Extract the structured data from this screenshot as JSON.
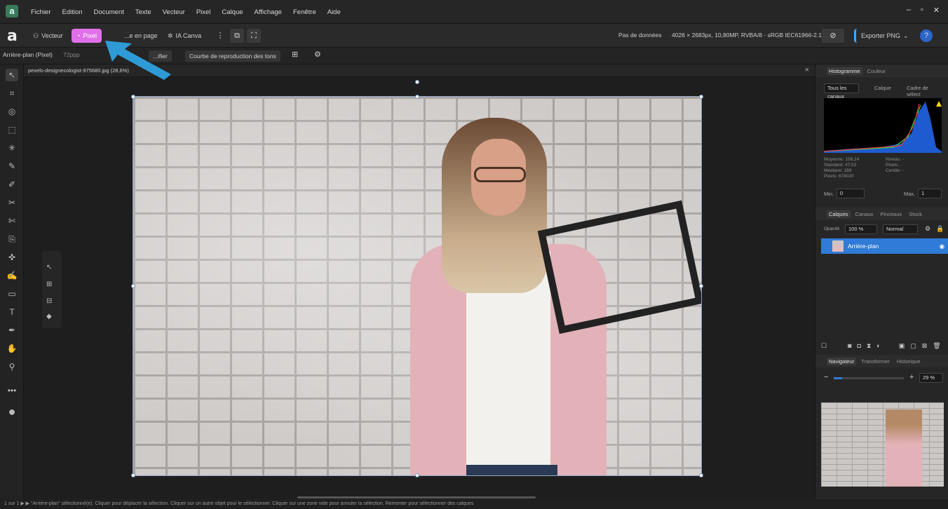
{
  "menubar": {
    "items": [
      "Fichier",
      "Edition",
      "Document",
      "Texte",
      "Vecteur",
      "Pixel",
      "Calque",
      "Affichage",
      "Fenêtre",
      "Aide"
    ],
    "controls": [
      "–",
      "▫",
      "✕"
    ]
  },
  "toolbar": {
    "logo": "a",
    "personas": [
      "Vecteur",
      "Pixel",
      "...e en page",
      "IA Canva"
    ],
    "no_data": "Pas de données",
    "doc_info": "4026 × 2683px, 10,80MP, RVBA/8 - sRGB IEC61966-2.1",
    "export": "Exporter PNG",
    "export_caret": "⌄",
    "help": "?"
  },
  "context": {
    "layer_label": "Arrière-plan (Pixel)",
    "dpi": "72ppp",
    "modify": "...ifier",
    "tone_curve": "Courbe de reproduction des tons"
  },
  "document": {
    "tab_name": "pexels-designecologist-975680.jpg (28,6%)",
    "close": "×"
  },
  "right": {
    "histogram_tabs": [
      "Histogramme",
      "Couleur"
    ],
    "histo_options": {
      "channels": "Tous les canaux",
      "calque": "Calque",
      "cadre": "Cadre de sélect"
    },
    "stats": {
      "moyenne": "Moyenne: 156,24",
      "standard": "Standard: 47,53",
      "mediane": "Médiane: 189",
      "pixels": "Pixels: 674020",
      "niveau": "Niveau: -",
      "pixels2": "Pixels: -",
      "centile": "Centile: -"
    },
    "min_label": "Min.",
    "min_val": "0",
    "max_label": "Max.",
    "max_val": "1",
    "layer_tabs": [
      "Calques",
      "Canaux",
      "Pinceaux",
      "Stock"
    ],
    "opacity_label": "Opacité",
    "opacity_val": "100 %",
    "blend": "Normal",
    "layer_name": "Arrière-plan",
    "nav_tabs": [
      "Navigateur",
      "Transformer",
      "Historique"
    ],
    "zoom": "29 %"
  },
  "status": "1 sur 1   ▶ ▶  \"Arrière-plan\" sélectionné(e). Cliquer pour déplacer la sélection. Cliquer sur un autre objet pour le sélectionner. Cliquer sur une zone vide pour annuler la sélection. Remonter pour sélectionner des calques",
  "colors": {
    "accent_pixel": "#e070e8",
    "selection": "#2f7bd6",
    "arrow": "#2e9bd6"
  }
}
